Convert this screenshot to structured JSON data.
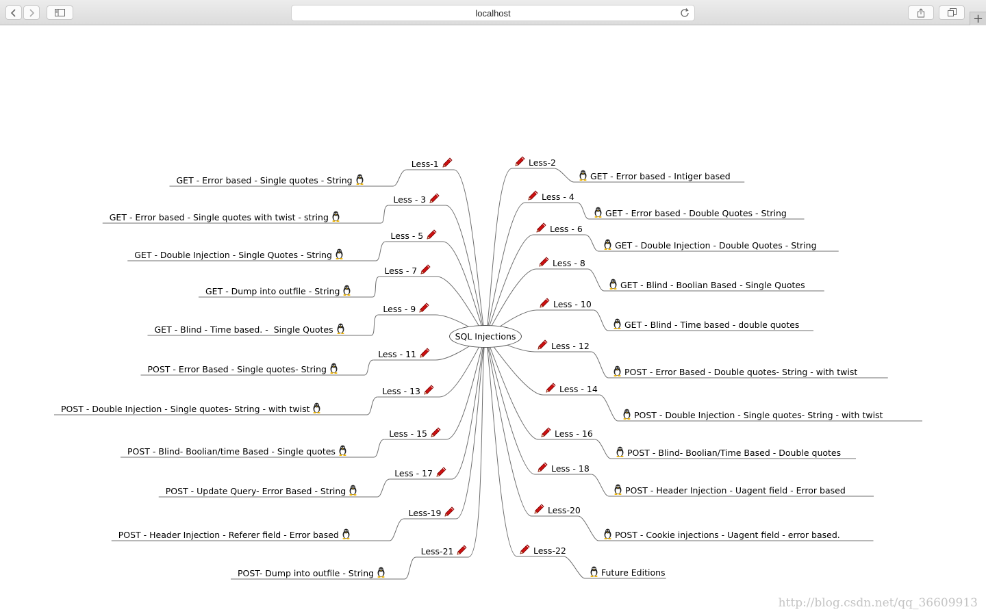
{
  "browser": {
    "url": "localhost",
    "buttons": {
      "back": "back-icon",
      "forward": "forward-icon",
      "sidebar": "sidebar-icon",
      "reload": "reload-icon",
      "share": "share-icon",
      "tabs": "tabs-icon",
      "new_tab": "+"
    }
  },
  "mindmap": {
    "center": "SQL Injections",
    "lessons": [
      {
        "label": "Less-1",
        "title": "GET - Error based - Single quotes - String"
      },
      {
        "label": "Less-2",
        "title": "GET - Error based - Intiger based"
      },
      {
        "label": "Less - 3",
        "title": "GET - Error based - Single quotes with twist - string"
      },
      {
        "label": "Less - 4",
        "title": "GET - Error based - Double Quotes - String"
      },
      {
        "label": "Less - 5",
        "title": "GET - Double Injection - Single Quotes - String"
      },
      {
        "label": "Less - 6",
        "title": "GET - Double Injection - Double Quotes - String"
      },
      {
        "label": "Less - 7",
        "title": "GET - Dump into outfile - String"
      },
      {
        "label": "Less - 8",
        "title": "GET - Blind - Boolian Based - Single Quotes"
      },
      {
        "label": "Less - 9",
        "title": "GET - Blind - Time based. -  Single Quotes"
      },
      {
        "label": "Less - 10",
        "title": "GET - Blind - Time based - double quotes"
      },
      {
        "label": "Less - 11",
        "title": "POST - Error Based - Single quotes- String"
      },
      {
        "label": "Less - 12",
        "title": "POST - Error Based - Double quotes- String - with twist"
      },
      {
        "label": "Less - 13",
        "title": "POST - Double Injection - Single quotes- String - with twist"
      },
      {
        "label": "Less - 14",
        "title": "POST - Double Injection - Single quotes- String - with twist"
      },
      {
        "label": "Less - 15",
        "title": "POST - Blind- Boolian/time Based - Single quotes"
      },
      {
        "label": "Less - 16",
        "title": "POST - Blind- Boolian/Time Based - Double quotes"
      },
      {
        "label": "Less - 17",
        "title": "POST - Update Query- Error Based - String"
      },
      {
        "label": "Less - 18",
        "title": "POST - Header Injection - Uagent field - Error based"
      },
      {
        "label": "Less-19",
        "title": "POST - Header Injection - Referer field - Error based"
      },
      {
        "label": "Less-20",
        "title": "POST - Cookie injections - Uagent field - error based."
      },
      {
        "label": "Less-21",
        "title": "POST- Dump into outfile - String"
      },
      {
        "label": "Less-22",
        "title": "Future Editions"
      }
    ]
  },
  "colors": {
    "branch": "#6f6f6f",
    "pencil": "#cc1111",
    "watermark": "#c4c4c4"
  },
  "watermark": "http://blog.csdn.net/qq_36609913"
}
